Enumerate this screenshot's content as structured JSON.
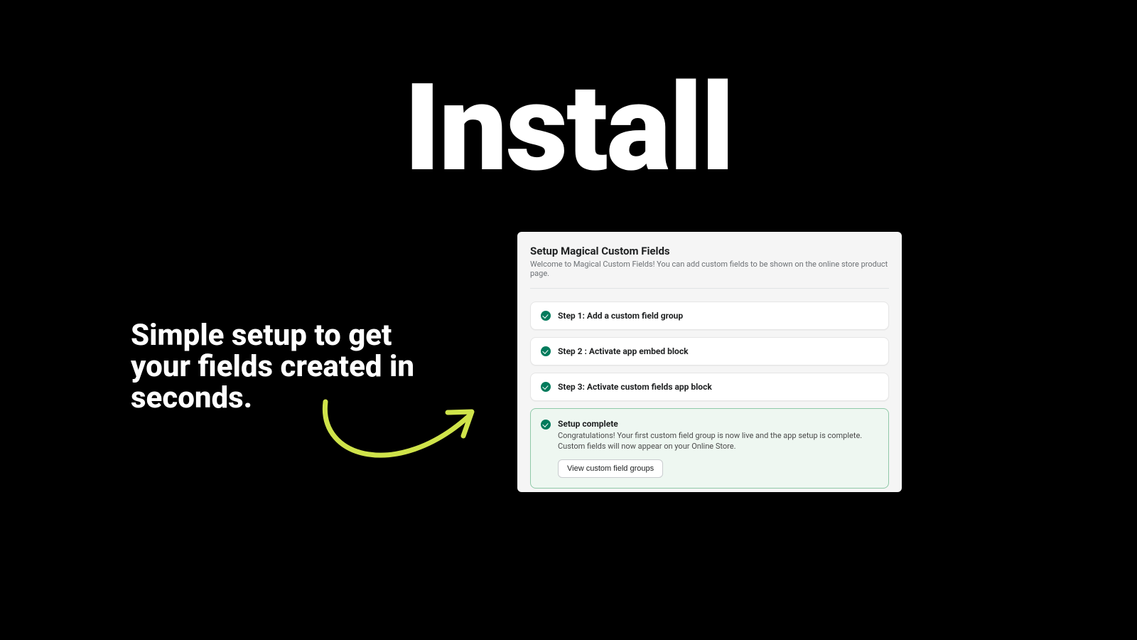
{
  "hero": {
    "title": "Install"
  },
  "subhead": "Simple setup to get your fields created in seconds.",
  "panel": {
    "title": "Setup Magical Custom Fields",
    "sub": "Welcome to Magical Custom Fields! You can add custom fields to be shown on the online store product page.",
    "steps": [
      "Step 1: Add a custom field group",
      "Step 2 : Activate app embed block",
      "Step 3: Activate custom fields app block"
    ],
    "complete": {
      "title": "Setup complete",
      "body": "Congratulations! Your first custom field group is now live and the app setup is complete. Custom fields will now appear on your Online Store.",
      "button": "View custom field groups"
    }
  },
  "colors": {
    "arrow": "#cfe34a",
    "accent_green": "#007b5c"
  }
}
